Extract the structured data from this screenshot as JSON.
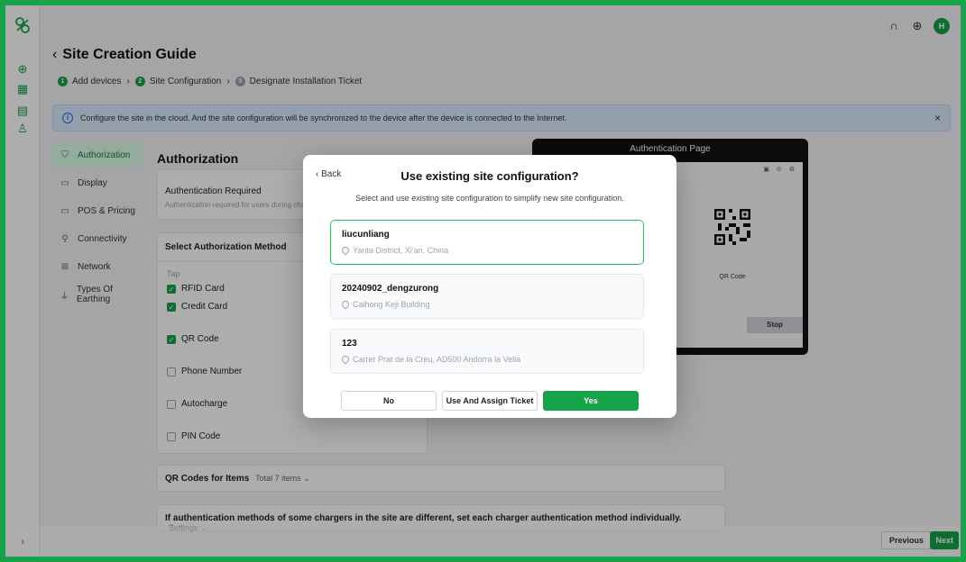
{
  "header": {
    "avatar_initial": "H",
    "icons": [
      "headset-icon",
      "globe-icon"
    ]
  },
  "page": {
    "title": "Site Creation Guide",
    "steps": [
      {
        "num": "1",
        "label": "Add devices"
      },
      {
        "num": "2",
        "label": "Site Configuration"
      },
      {
        "num": "3",
        "label": "Designate Installation Ticket"
      }
    ]
  },
  "banner": {
    "text": "Configure the site in the cloud. And the site configuration will be synchronized to the device after the device is connected to the Internet."
  },
  "nav": {
    "items": [
      {
        "label": "Authorization",
        "icon": "shield-icon"
      },
      {
        "label": "Display",
        "icon": "monitor-icon"
      },
      {
        "label": "POS & Pricing",
        "icon": "card-icon"
      },
      {
        "label": "Connectivity",
        "icon": "connectivity-icon"
      },
      {
        "label": "Network",
        "icon": "network-icon"
      },
      {
        "label": "Types Of Earthing",
        "icon": "earthing-icon"
      }
    ]
  },
  "main": {
    "section_title": "Authorization",
    "auth_required_title": "Authentication Required",
    "auth_required_sub": "Authentication required for users during charging",
    "select_method_title": "Select Authorization Method",
    "tap_label": "Tap",
    "methods": [
      {
        "label": "RFID Card",
        "checked": true
      },
      {
        "label": "Credit Card",
        "checked": true
      },
      {
        "label": "QR Code",
        "checked": true
      },
      {
        "label": "Phone Number",
        "checked": false
      },
      {
        "label": "Autocharge",
        "checked": false
      },
      {
        "label": "PIN Code",
        "checked": false
      }
    ],
    "qr_items_title": "QR Codes for Items",
    "qr_items_sub": "Total 7 items ⌄",
    "individual_title": "If authentication methods of some chargers in the site are different, set each charger authentication method individually.",
    "individual_sub": "Settings ⌄"
  },
  "preview": {
    "title": "Authentication Page",
    "qr_label": "QR Code",
    "stop_label": "Stop"
  },
  "modal": {
    "back_label": "Back",
    "title": "Use existing site configuration?",
    "subtitle": "Select and use existing site configuration to simplify new site configuration.",
    "options": [
      {
        "name": "liucunliang",
        "address": "Yanta District, Xi'an, China",
        "selected": true
      },
      {
        "name": "20240902_dengzurong",
        "address": "Caihong Keji Building",
        "selected": false
      },
      {
        "name": "123",
        "address": "Carrer Prat de la Creu, AD500 Andorra la Vella",
        "selected": false
      }
    ],
    "no_label": "No",
    "assign_label": "Use And Assign Ticket",
    "yes_label": "Yes"
  },
  "footer": {
    "previous_label": "Previous",
    "next_label": "Next"
  },
  "colors": {
    "accent": "#16a34a",
    "banner_bg": "#dbeafe",
    "overlay": "rgba(0,0,0,0.32)"
  }
}
